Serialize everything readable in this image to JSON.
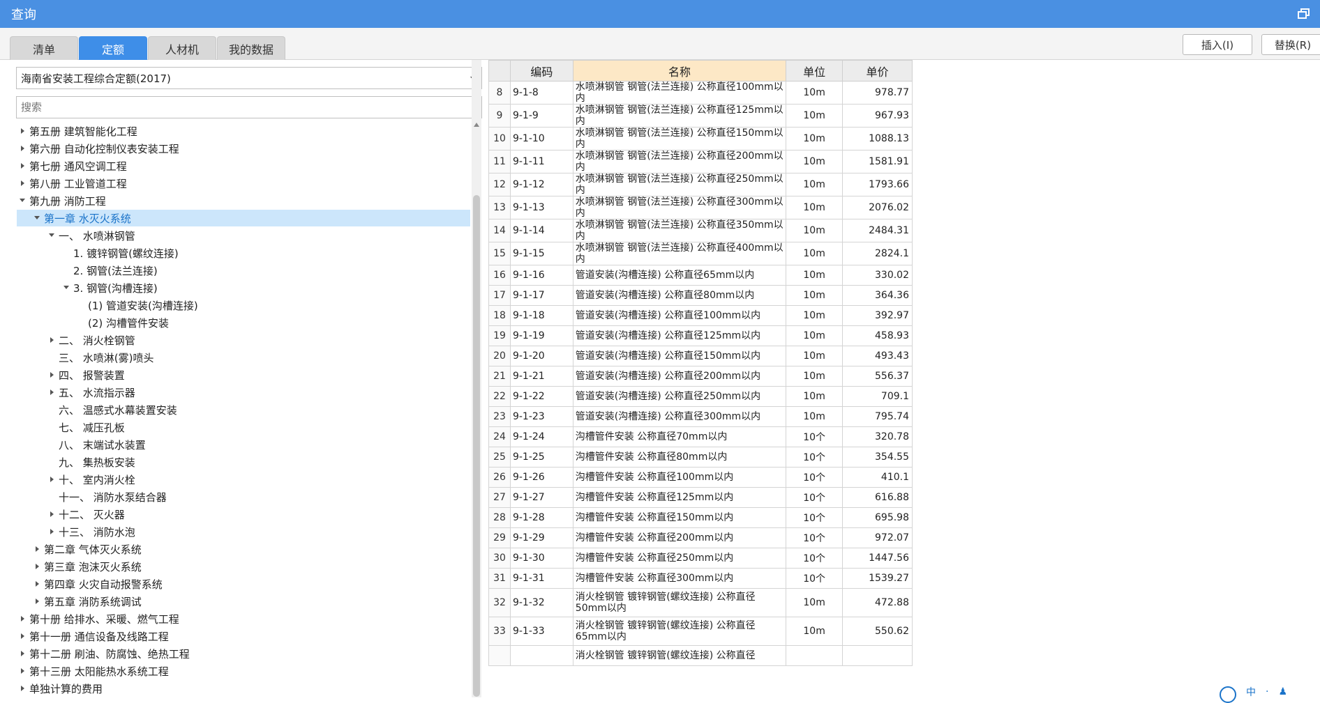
{
  "window": {
    "title": "查询"
  },
  "tabs": [
    {
      "label": "清单",
      "active": false
    },
    {
      "label": "定额",
      "active": true
    },
    {
      "label": "人材机",
      "active": false
    },
    {
      "label": "我的数据",
      "active": false
    }
  ],
  "toolbar": {
    "insert_label": "插入(I)",
    "replace_label": "替换(R)"
  },
  "left": {
    "dropdown_value": "海南省安装工程综合定额(2017)",
    "search_placeholder": "搜索",
    "tree": [
      {
        "label": "第五册 建筑智能化工程",
        "level": 0,
        "state": "collapsed"
      },
      {
        "label": "第六册 自动化控制仪表安装工程",
        "level": 0,
        "state": "collapsed"
      },
      {
        "label": "第七册 通风空调工程",
        "level": 0,
        "state": "collapsed"
      },
      {
        "label": "第八册 工业管道工程",
        "level": 0,
        "state": "collapsed"
      },
      {
        "label": "第九册 消防工程",
        "level": 0,
        "state": "expanded"
      },
      {
        "label": "第一章 水灭火系统",
        "level": 1,
        "state": "expanded",
        "selected": true
      },
      {
        "label": "一、 水喷淋钢管",
        "level": 2,
        "state": "expanded"
      },
      {
        "label": "1. 镀锌钢管(螺纹连接)",
        "level": 3,
        "state": "leaf"
      },
      {
        "label": "2. 钢管(法兰连接)",
        "level": 3,
        "state": "leaf"
      },
      {
        "label": "3. 钢管(沟槽连接)",
        "level": 3,
        "state": "expanded"
      },
      {
        "label": "(1) 管道安装(沟槽连接)",
        "level": 4,
        "state": "leaf"
      },
      {
        "label": "(2) 沟槽管件安装",
        "level": 4,
        "state": "leaf"
      },
      {
        "label": "二、 消火栓钢管",
        "level": 2,
        "state": "collapsed"
      },
      {
        "label": "三、 水喷淋(雾)喷头",
        "level": 2,
        "state": "leaf"
      },
      {
        "label": "四、 报警装置",
        "level": 2,
        "state": "collapsed"
      },
      {
        "label": "五、 水流指示器",
        "level": 2,
        "state": "collapsed"
      },
      {
        "label": "六、 温感式水幕装置安装",
        "level": 2,
        "state": "leaf"
      },
      {
        "label": "七、 减压孔板",
        "level": 2,
        "state": "leaf"
      },
      {
        "label": "八、 末端试水装置",
        "level": 2,
        "state": "leaf"
      },
      {
        "label": "九、 集热板安装",
        "level": 2,
        "state": "leaf"
      },
      {
        "label": "十、 室内消火栓",
        "level": 2,
        "state": "collapsed"
      },
      {
        "label": "十一、 消防水泵结合器",
        "level": 2,
        "state": "leaf"
      },
      {
        "label": "十二、 灭火器",
        "level": 2,
        "state": "collapsed"
      },
      {
        "label": "十三、 消防水泡",
        "level": 2,
        "state": "collapsed"
      },
      {
        "label": "第二章 气体灭火系统",
        "level": 1,
        "state": "collapsed"
      },
      {
        "label": "第三章 泡沫灭火系统",
        "level": 1,
        "state": "collapsed"
      },
      {
        "label": "第四章 火灾自动报警系统",
        "level": 1,
        "state": "collapsed"
      },
      {
        "label": "第五章 消防系统调试",
        "level": 1,
        "state": "collapsed"
      },
      {
        "label": "第十册 给排水、采暖、燃气工程",
        "level": 0,
        "state": "collapsed"
      },
      {
        "label": "第十一册 通信设备及线路工程",
        "level": 0,
        "state": "collapsed"
      },
      {
        "label": "第十二册 刷油、防腐蚀、绝热工程",
        "level": 0,
        "state": "collapsed"
      },
      {
        "label": "第十三册 太阳能热水系统工程",
        "level": 0,
        "state": "collapsed"
      },
      {
        "label": "单独计算的费用",
        "level": 0,
        "state": "collapsed"
      }
    ]
  },
  "table": {
    "headers": {
      "code": "编码",
      "name": "名称",
      "unit": "单位",
      "price": "单价"
    },
    "rows": [
      {
        "idx": "8",
        "code": "9-1-8",
        "name": "水喷淋钢管 钢管(法兰连接) 公称直径100mm以内",
        "unit": "10m",
        "price": "978.77"
      },
      {
        "idx": "9",
        "code": "9-1-9",
        "name": "水喷淋钢管 钢管(法兰连接) 公称直径125mm以内",
        "unit": "10m",
        "price": "967.93"
      },
      {
        "idx": "10",
        "code": "9-1-10",
        "name": "水喷淋钢管 钢管(法兰连接) 公称直径150mm以内",
        "unit": "10m",
        "price": "1088.13"
      },
      {
        "idx": "11",
        "code": "9-1-11",
        "name": "水喷淋钢管 钢管(法兰连接) 公称直径200mm以内",
        "unit": "10m",
        "price": "1581.91"
      },
      {
        "idx": "12",
        "code": "9-1-12",
        "name": "水喷淋钢管 钢管(法兰连接) 公称直径250mm以内",
        "unit": "10m",
        "price": "1793.66"
      },
      {
        "idx": "13",
        "code": "9-1-13",
        "name": "水喷淋钢管 钢管(法兰连接) 公称直径300mm以内",
        "unit": "10m",
        "price": "2076.02"
      },
      {
        "idx": "14",
        "code": "9-1-14",
        "name": "水喷淋钢管 钢管(法兰连接) 公称直径350mm以内",
        "unit": "10m",
        "price": "2484.31"
      },
      {
        "idx": "15",
        "code": "9-1-15",
        "name": "水喷淋钢管 钢管(法兰连接) 公称直径400mm以内",
        "unit": "10m",
        "price": "2824.1"
      },
      {
        "idx": "16",
        "code": "9-1-16",
        "name": "管道安装(沟槽连接) 公称直径65mm以内",
        "unit": "10m",
        "price": "330.02"
      },
      {
        "idx": "17",
        "code": "9-1-17",
        "name": "管道安装(沟槽连接) 公称直径80mm以内",
        "unit": "10m",
        "price": "364.36"
      },
      {
        "idx": "18",
        "code": "9-1-18",
        "name": "管道安装(沟槽连接) 公称直径100mm以内",
        "unit": "10m",
        "price": "392.97"
      },
      {
        "idx": "19",
        "code": "9-1-19",
        "name": "管道安装(沟槽连接) 公称直径125mm以内",
        "unit": "10m",
        "price": "458.93"
      },
      {
        "idx": "20",
        "code": "9-1-20",
        "name": "管道安装(沟槽连接) 公称直径150mm以内",
        "unit": "10m",
        "price": "493.43"
      },
      {
        "idx": "21",
        "code": "9-1-21",
        "name": "管道安装(沟槽连接) 公称直径200mm以内",
        "unit": "10m",
        "price": "556.37"
      },
      {
        "idx": "22",
        "code": "9-1-22",
        "name": "管道安装(沟槽连接) 公称直径250mm以内",
        "unit": "10m",
        "price": "709.1"
      },
      {
        "idx": "23",
        "code": "9-1-23",
        "name": "管道安装(沟槽连接) 公称直径300mm以内",
        "unit": "10m",
        "price": "795.74"
      },
      {
        "idx": "24",
        "code": "9-1-24",
        "name": "沟槽管件安装 公称直径70mm以内",
        "unit": "10个",
        "price": "320.78"
      },
      {
        "idx": "25",
        "code": "9-1-25",
        "name": "沟槽管件安装 公称直径80mm以内",
        "unit": "10个",
        "price": "354.55"
      },
      {
        "idx": "26",
        "code": "9-1-26",
        "name": "沟槽管件安装 公称直径100mm以内",
        "unit": "10个",
        "price": "410.1"
      },
      {
        "idx": "27",
        "code": "9-1-27",
        "name": "沟槽管件安装 公称直径125mm以内",
        "unit": "10个",
        "price": "616.88"
      },
      {
        "idx": "28",
        "code": "9-1-28",
        "name": "沟槽管件安装 公称直径150mm以内",
        "unit": "10个",
        "price": "695.98"
      },
      {
        "idx": "29",
        "code": "9-1-29",
        "name": "沟槽管件安装 公称直径200mm以内",
        "unit": "10个",
        "price": "972.07"
      },
      {
        "idx": "30",
        "code": "9-1-30",
        "name": "沟槽管件安装 公称直径250mm以内",
        "unit": "10个",
        "price": "1447.56"
      },
      {
        "idx": "31",
        "code": "9-1-31",
        "name": "沟槽管件安装 公称直径300mm以内",
        "unit": "10个",
        "price": "1539.27"
      },
      {
        "idx": "32",
        "code": "9-1-32",
        "name": "消火栓钢管 镀锌钢管(螺纹连接) 公称直径50mm以内",
        "unit": "10m",
        "price": "472.88"
      },
      {
        "idx": "33",
        "code": "9-1-33",
        "name": "消火栓钢管 镀锌钢管(螺纹连接) 公称直径65mm以内",
        "unit": "10m",
        "price": "550.62"
      },
      {
        "idx": "",
        "code": "",
        "name": "消火栓钢管 镀锌钢管(螺纹连接) 公称直径",
        "unit": "",
        "price": ""
      }
    ]
  },
  "ime": {
    "lang": "中"
  },
  "colors": {
    "accent": "#4a90e2",
    "tab_active": "#3e8ee8",
    "selected_row": "#cce6fb",
    "name_header": "#fde8c6"
  }
}
